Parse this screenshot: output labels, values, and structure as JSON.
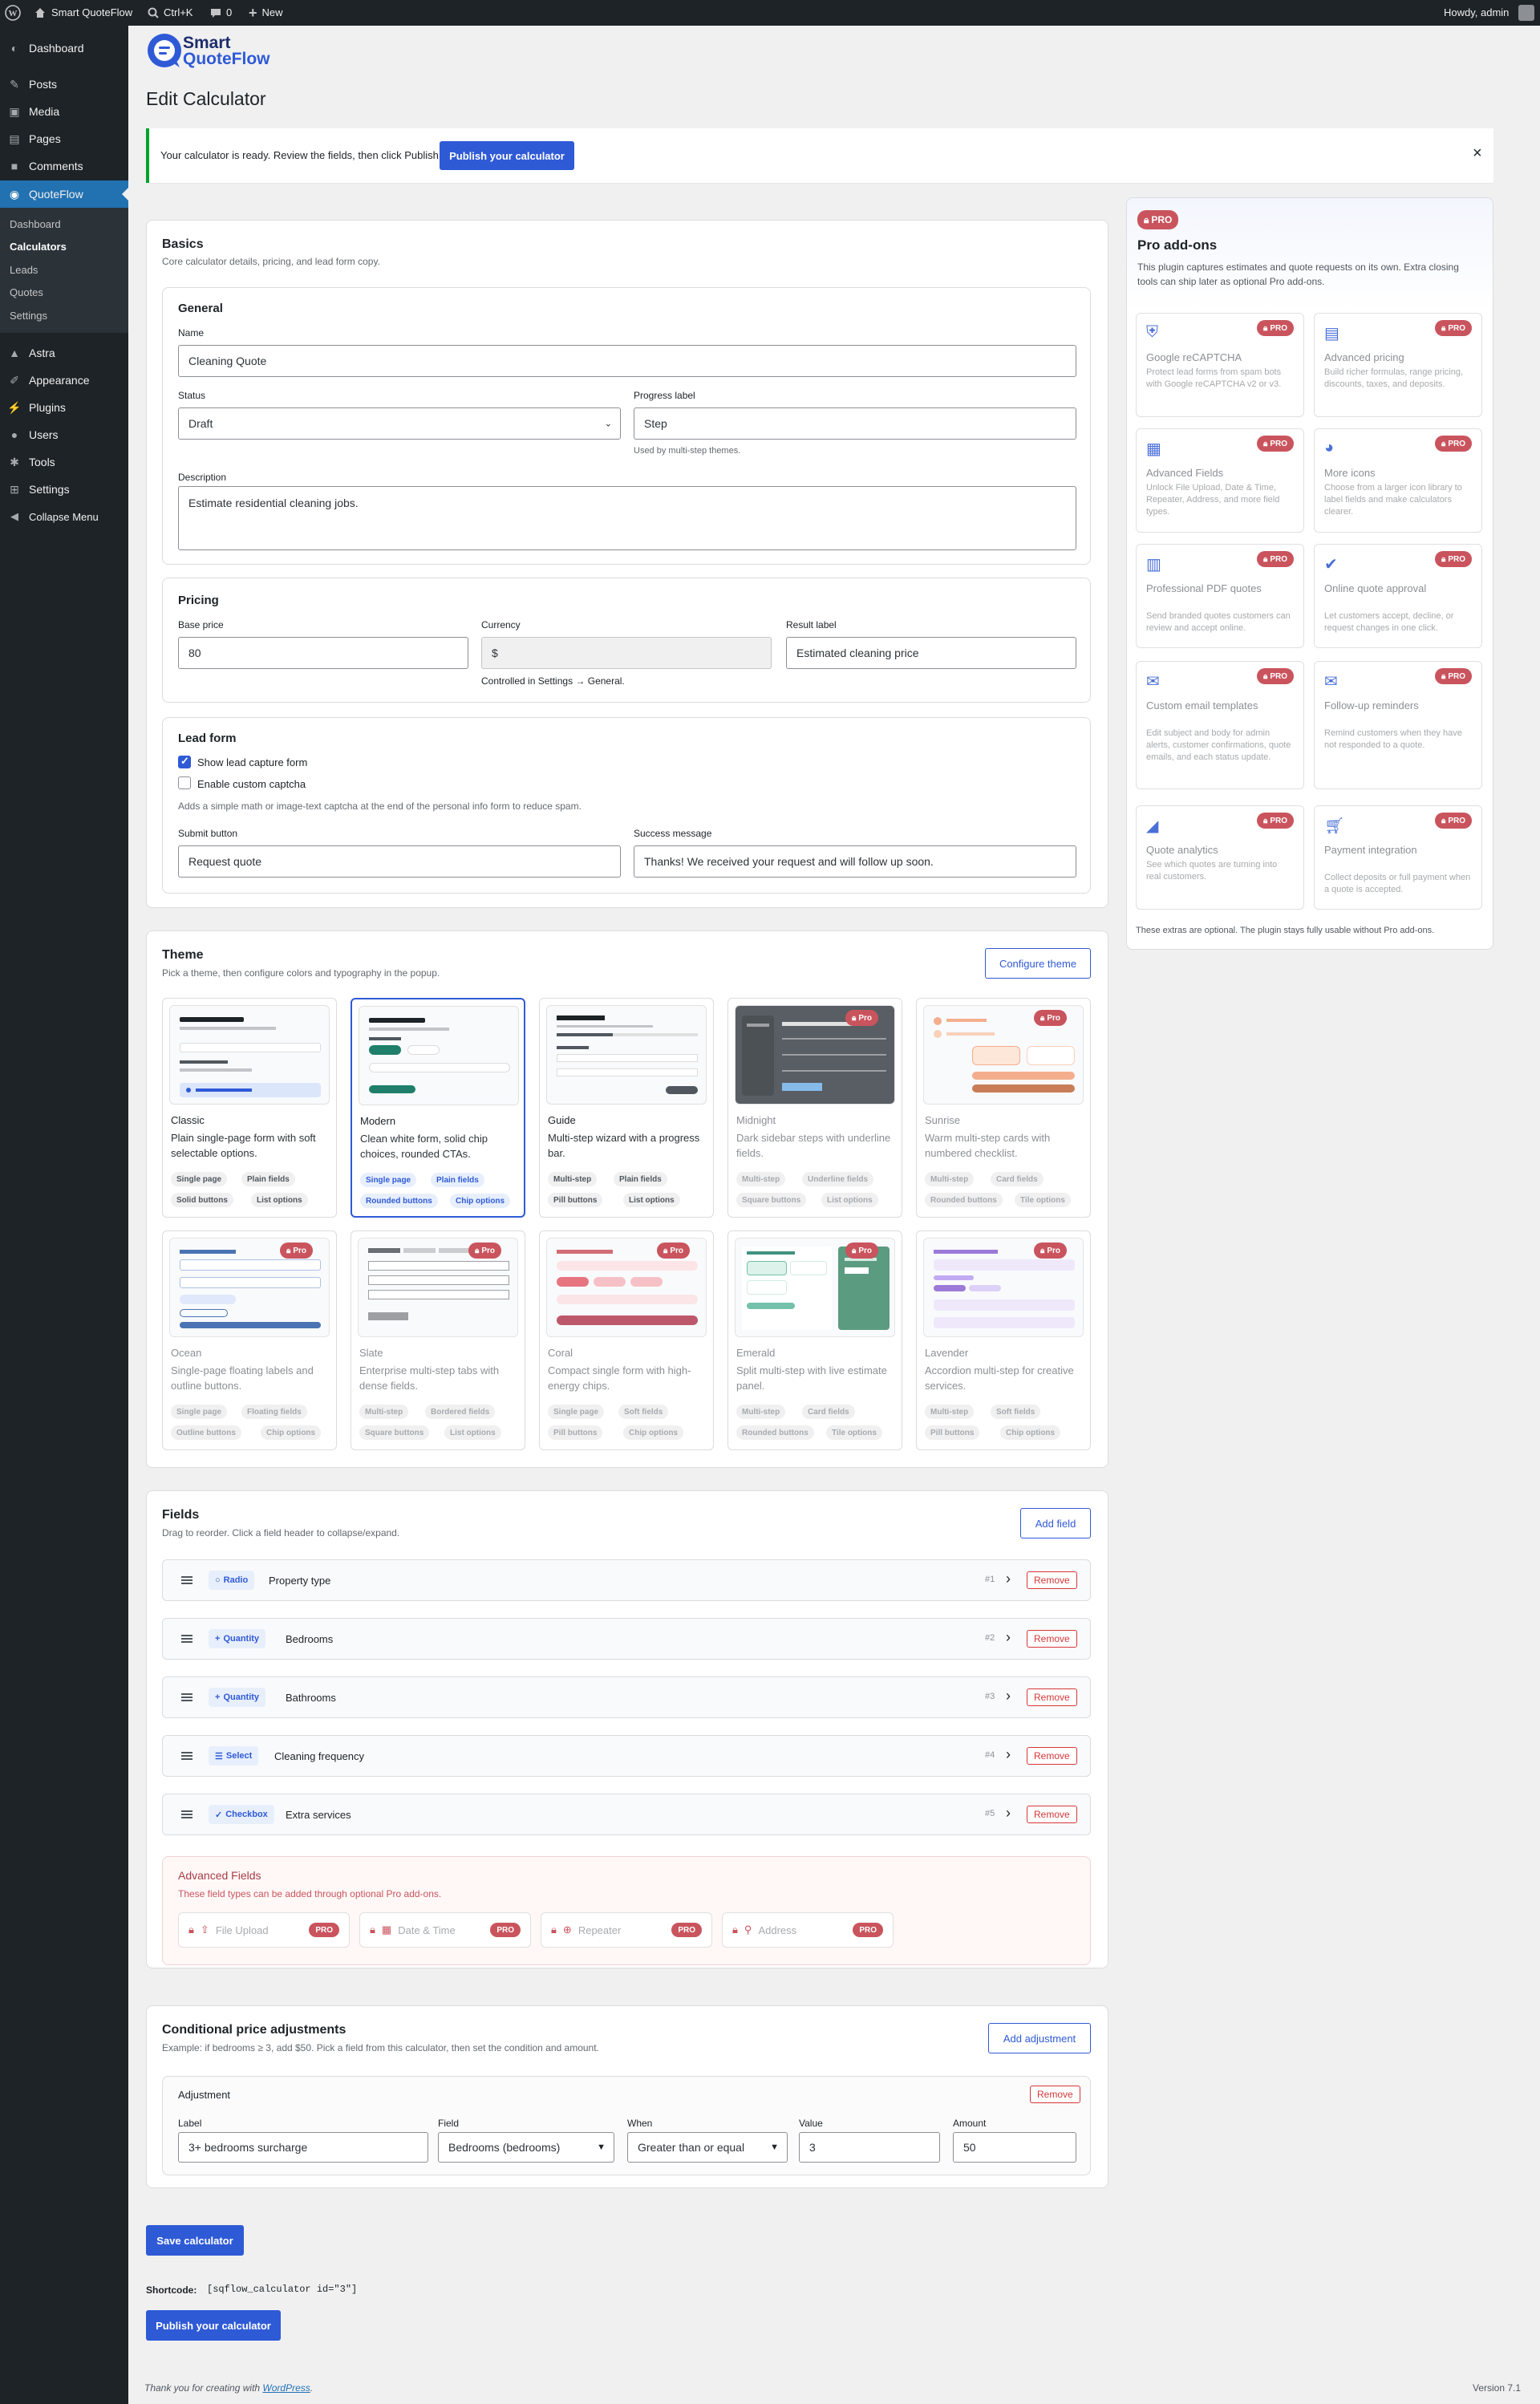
{
  "adminbar": {
    "site_name": "Smart QuoteFlow",
    "search": "Ctrl+K",
    "comments": "0",
    "new": "New",
    "howdy": "Howdy, admin"
  },
  "sidebar": {
    "items": [
      {
        "label": "Dashboard",
        "icon": "dashboard-icon"
      },
      {
        "label": "Posts",
        "icon": "pin-icon"
      },
      {
        "label": "Media",
        "icon": "media-icon"
      },
      {
        "label": "Pages",
        "icon": "pages-icon"
      },
      {
        "label": "Comments",
        "icon": "comments-icon"
      },
      {
        "label": "QuoteFlow",
        "icon": "quoteflow-icon"
      },
      {
        "label": "Astra",
        "icon": "astra-icon"
      },
      {
        "label": "Appearance",
        "icon": "appearance-icon"
      },
      {
        "label": "Plugins",
        "icon": "plugins-icon"
      },
      {
        "label": "Users",
        "icon": "users-icon"
      },
      {
        "label": "Tools",
        "icon": "tools-icon"
      },
      {
        "label": "Settings",
        "icon": "settings-icon"
      },
      {
        "label": "Collapse Menu",
        "icon": "collapse-icon"
      }
    ],
    "submenu": [
      "Dashboard",
      "Calculators",
      "Leads",
      "Quotes",
      "Settings"
    ]
  },
  "logo": {
    "line1": "Smart",
    "line2": "QuoteFlow"
  },
  "page_title": "Edit Calculator",
  "notice": {
    "text": "Your calculator is ready. Review the fields, then click Publish.",
    "button": "Publish your calculator",
    "close": "×"
  },
  "basics": {
    "title": "Basics",
    "subtitle": "Core calculator details, pricing, and lead form copy.",
    "general": {
      "title": "General",
      "name_label": "Name",
      "name_value": "Cleaning Quote",
      "status_label": "Status",
      "status_value": "Draft",
      "progress_label": "Progress label",
      "progress_value": "Step",
      "progress_help": "Used by multi-step themes.",
      "description_label": "Description",
      "description_value": "Estimate residential cleaning jobs."
    },
    "pricing": {
      "title": "Pricing",
      "base_label": "Base price",
      "base_value": "80",
      "currency_label": "Currency",
      "currency_value": "$",
      "currency_help": "Controlled in Settings → General.",
      "result_label": "Result label",
      "result_value": "Estimated cleaning price"
    },
    "lead": {
      "title": "Lead form",
      "show_label": "Show lead capture form",
      "captcha_label": "Enable custom captcha",
      "captcha_help": "Adds a simple math or image-text captcha at the end of the personal info form to reduce spam.",
      "submit_label": "Submit button",
      "submit_value": "Request quote",
      "success_label": "Success message",
      "success_value": "Thanks! We received your request and will follow up soon."
    }
  },
  "theme": {
    "title": "Theme",
    "subtitle": "Pick a theme, then configure colors and typography in the popup.",
    "configure": "Configure theme",
    "pro_label": "Pro",
    "items": [
      {
        "name": "Classic",
        "desc": "Plain single-page form with soft selectable options.",
        "tags": [
          "Single page",
          "Plain fields",
          "Solid buttons",
          "List options"
        ]
      },
      {
        "name": "Modern",
        "desc": "Clean white form, solid chip choices, rounded CTAs.",
        "tags": [
          "Single page",
          "Plain fields",
          "Rounded buttons",
          "Chip options"
        ]
      },
      {
        "name": "Guide",
        "desc": "Multi-step wizard with a progress bar.",
        "tags": [
          "Multi-step",
          "Plain fields",
          "Pill buttons",
          "List options"
        ]
      },
      {
        "name": "Midnight",
        "desc": "Dark sidebar steps with underline fields.",
        "tags": [
          "Multi-step",
          "Underline fields",
          "Square buttons",
          "List options"
        ]
      },
      {
        "name": "Sunrise",
        "desc": "Warm multi-step cards with numbered checklist.",
        "tags": [
          "Multi-step",
          "Card fields",
          "Rounded buttons",
          "Tile options"
        ]
      },
      {
        "name": "Ocean",
        "desc": "Single-page floating labels and outline buttons.",
        "tags": [
          "Single page",
          "Floating fields",
          "Outline buttons",
          "Chip options"
        ]
      },
      {
        "name": "Slate",
        "desc": "Enterprise multi-step tabs with dense fields.",
        "tags": [
          "Multi-step",
          "Bordered fields",
          "Square buttons",
          "List options"
        ]
      },
      {
        "name": "Coral",
        "desc": "Compact single form with high-energy chips.",
        "tags": [
          "Single page",
          "Soft fields",
          "Pill buttons",
          "Chip options"
        ]
      },
      {
        "name": "Emerald",
        "desc": "Split multi-step with live estimate panel.",
        "tags": [
          "Multi-step",
          "Card fields",
          "Rounded buttons",
          "Tile options"
        ]
      },
      {
        "name": "Lavender",
        "desc": "Accordion multi-step for creative services.",
        "tags": [
          "Multi-step",
          "Soft fields",
          "Pill buttons",
          "Chip options"
        ]
      }
    ]
  },
  "fields": {
    "title": "Fields",
    "subtitle": "Drag to reorder. Click a field header to collapse/expand.",
    "add": "Add field",
    "remove": "Remove",
    "rows": [
      {
        "type": "Radio",
        "icon": "radio-icon",
        "name": "Property type",
        "num": "#1"
      },
      {
        "type": "Quantity",
        "icon": "plus-icon",
        "name": "Bedrooms",
        "num": "#2"
      },
      {
        "type": "Quantity",
        "icon": "plus-icon",
        "name": "Bathrooms",
        "num": "#3"
      },
      {
        "type": "Select",
        "icon": "list-icon",
        "name": "Cleaning frequency",
        "num": "#4"
      },
      {
        "type": "Checkbox",
        "icon": "check-icon",
        "name": "Extra services",
        "num": "#5"
      }
    ],
    "advanced": {
      "title": "Advanced Fields",
      "subtitle": "These field types can be added through optional Pro add-ons.",
      "pro": "PRO",
      "items": [
        {
          "label": "File Upload",
          "icon": "upload-icon"
        },
        {
          "label": "Date & Time",
          "icon": "calendar-icon"
        },
        {
          "label": "Repeater",
          "icon": "repeater-icon"
        },
        {
          "label": "Address",
          "icon": "pin-location-icon"
        }
      ]
    }
  },
  "conditional": {
    "title": "Conditional price adjustments",
    "subtitle": "Example: if bedrooms ≥ 3, add $50. Pick a field from this calculator, then set the condition and amount.",
    "add": "Add adjustment",
    "adj_title": "Adjustment",
    "remove": "Remove",
    "label_label": "Label",
    "label_value": "3+ bedrooms surcharge",
    "field_label": "Field",
    "field_value": "Bedrooms (bedrooms)",
    "when_label": "When",
    "when_value": "Greater than or equal",
    "value_label": "Value",
    "value_value": "3",
    "amount_label": "Amount",
    "amount_value": "50"
  },
  "save": "Save calculator",
  "shortcode_label": "Shortcode:",
  "shortcode_value": "[sqflow_calculator id=\"3\"]",
  "publish": "Publish your calculator",
  "footer": {
    "thanks": "Thank you for creating with",
    "wp": "WordPress",
    "version": "Version 7.1"
  },
  "proaddons": {
    "badge": "PRO",
    "title": "Pro add-ons",
    "desc": "This plugin captures estimates and quote requests on its own. Extra closing tools can ship later as optional Pro add-ons.",
    "items": [
      {
        "title": "Google reCAPTCHA",
        "desc": "Protect lead forms from spam bots with Google reCAPTCHA v2 or v3.",
        "icon": "shield-icon"
      },
      {
        "title": "Advanced pricing",
        "desc": "Build richer formulas, range pricing, discounts, taxes, and deposits.",
        "icon": "document-icon"
      },
      {
        "title": "Advanced Fields",
        "desc": "Unlock File Upload, Date & Time, Repeater, Address, and more field types.",
        "icon": "grid-icon"
      },
      {
        "title": "More icons",
        "desc": "Choose from a larger icon library to label fields and make calculators clearer.",
        "icon": "palette-icon"
      },
      {
        "title": "Professional PDF quotes",
        "desc": "Send branded quotes customers can review and accept online.",
        "icon": "pdf-icon"
      },
      {
        "title": "Online quote approval",
        "desc": "Let customers accept, decline, or request changes in one click.",
        "icon": "checkmark-icon"
      },
      {
        "title": "Custom email templates",
        "desc": "Edit subject and body for admin alerts, customer confirmations, quote emails, and each status update.",
        "icon": "email-icon"
      },
      {
        "title": "Follow-up reminders",
        "desc": "Remind customers when they have not responded to a quote.",
        "icon": "email-icon"
      },
      {
        "title": "Quote analytics",
        "desc": "See which quotes are turning into real customers.",
        "icon": "chart-icon"
      },
      {
        "title": "Payment integration",
        "desc": "Collect deposits or full payment when a quote is accepted.",
        "icon": "cart-icon"
      }
    ],
    "footer": "These extras are optional. The plugin stays fully usable without Pro add-ons."
  }
}
